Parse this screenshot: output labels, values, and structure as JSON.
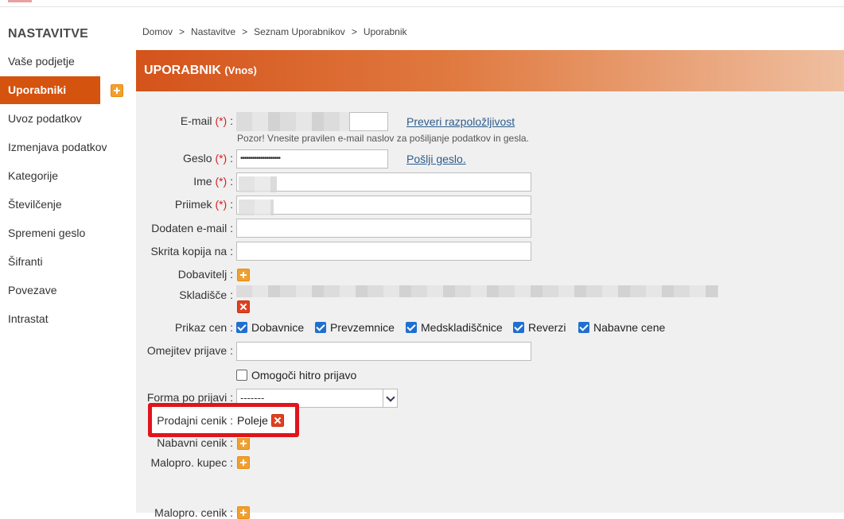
{
  "sidebar": {
    "heading": "NASTAVITVE",
    "items": [
      {
        "label": "Vaše podjetje",
        "active": false
      },
      {
        "label": "Uporabniki",
        "active": true
      },
      {
        "label": "Uvoz podatkov",
        "active": false
      },
      {
        "label": "Izmenjava podatkov",
        "active": false
      },
      {
        "label": "Kategorije",
        "active": false
      },
      {
        "label": "Številčenje",
        "active": false
      },
      {
        "label": "Spremeni geslo",
        "active": false
      },
      {
        "label": "Šifranti",
        "active": false
      },
      {
        "label": "Povezave",
        "active": false
      },
      {
        "label": "Intrastat",
        "active": false
      }
    ]
  },
  "breadcrumb": {
    "items": [
      "Domov",
      "Nastavitve",
      "Seznam Uporabnikov",
      "Uporabnik"
    ],
    "separator": ">"
  },
  "header": {
    "title": "UPORABNIK",
    "subtitle": "(Vnos)"
  },
  "form": {
    "required_mark": "(*)",
    "email": {
      "label": "E-mail",
      "value": ""
    },
    "check_availability": "Preveri razpoložljivost",
    "email_note": "Pozor! Vnesite pravilen e-mail naslov za pošiljanje podatkov in gesla.",
    "password": {
      "label": "Geslo",
      "value": "••••••••••••••••••••"
    },
    "send_password": "Pošlji geslo.",
    "first_name": {
      "label": "Ime",
      "value": ""
    },
    "last_name": {
      "label": "Priimek",
      "value": ""
    },
    "extra_email": {
      "label": "Dodaten e-mail",
      "value": ""
    },
    "bcc": {
      "label": "Skrita kopija na",
      "value": ""
    },
    "supplier": {
      "label": "Dobavitelj"
    },
    "warehouse": {
      "label": "Skladišče"
    },
    "price_display": {
      "label": "Prikaz cen",
      "options": [
        {
          "label": "Dobavnice",
          "checked": true
        },
        {
          "label": "Prevzemnice",
          "checked": true
        },
        {
          "label": "Medskladiščnice",
          "checked": true
        },
        {
          "label": "Reverzi",
          "checked": true
        },
        {
          "label": "Nabavne cene",
          "checked": true
        }
      ]
    },
    "login_restriction": {
      "label": "Omejitev prijave",
      "value": ""
    },
    "quick_login": {
      "label": "Omogoči hitro prijavo",
      "checked": false
    },
    "login_form": {
      "label": "Forma po prijavi",
      "value": "-------"
    },
    "sales_pricelist": {
      "label": "Prodajni cenik",
      "value": "Poleje"
    },
    "purchase_pricelist": {
      "label": "Nabavni cenik"
    },
    "retail_customer": {
      "label": "Malopro. kupec"
    },
    "retail_pricelist": {
      "label": "Malopro. cenik"
    },
    "colon": ":"
  },
  "colors": {
    "accent": "#d4530f",
    "highlight": "#e0151c",
    "checkbox": "#1f6fd0"
  }
}
